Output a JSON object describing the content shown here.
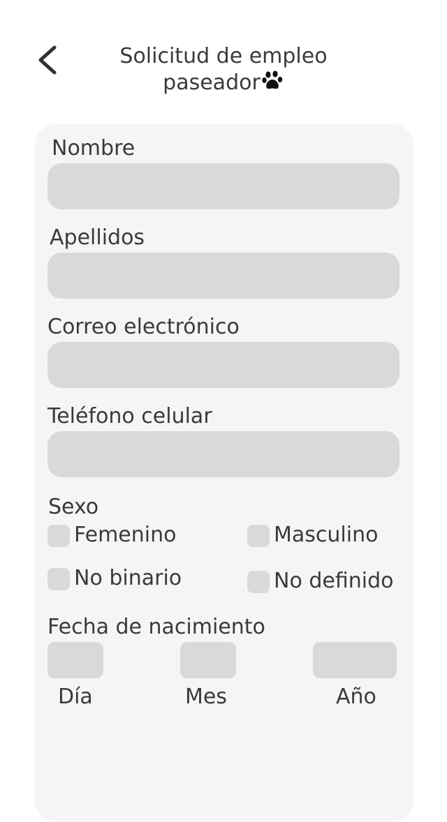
{
  "header": {
    "title_line1": "Solicitud de empleo",
    "title_line2": "paseador",
    "back_icon": "chevron-left-icon",
    "title_icon": "paw-icon"
  },
  "form": {
    "nombre_label": "Nombre",
    "nombre_value": "",
    "apellidos_label": "Apellidos",
    "apellidos_value": "",
    "correo_label": "Correo electrónico",
    "correo_value": "",
    "telefono_label": "Teléfono celular",
    "telefono_value": "",
    "sexo_label": "Sexo",
    "sexo_options": [
      "Femenino",
      "Masculino",
      "No binario",
      "No definido"
    ],
    "fecha_label": "Fecha de nacimiento",
    "dia_label": "Día",
    "mes_label": "Mes",
    "anio_label": "Año"
  },
  "colors": {
    "card_bg": "#f5f5f5",
    "field_bg": "#d9d9d9",
    "text": "#3a3a3a"
  }
}
